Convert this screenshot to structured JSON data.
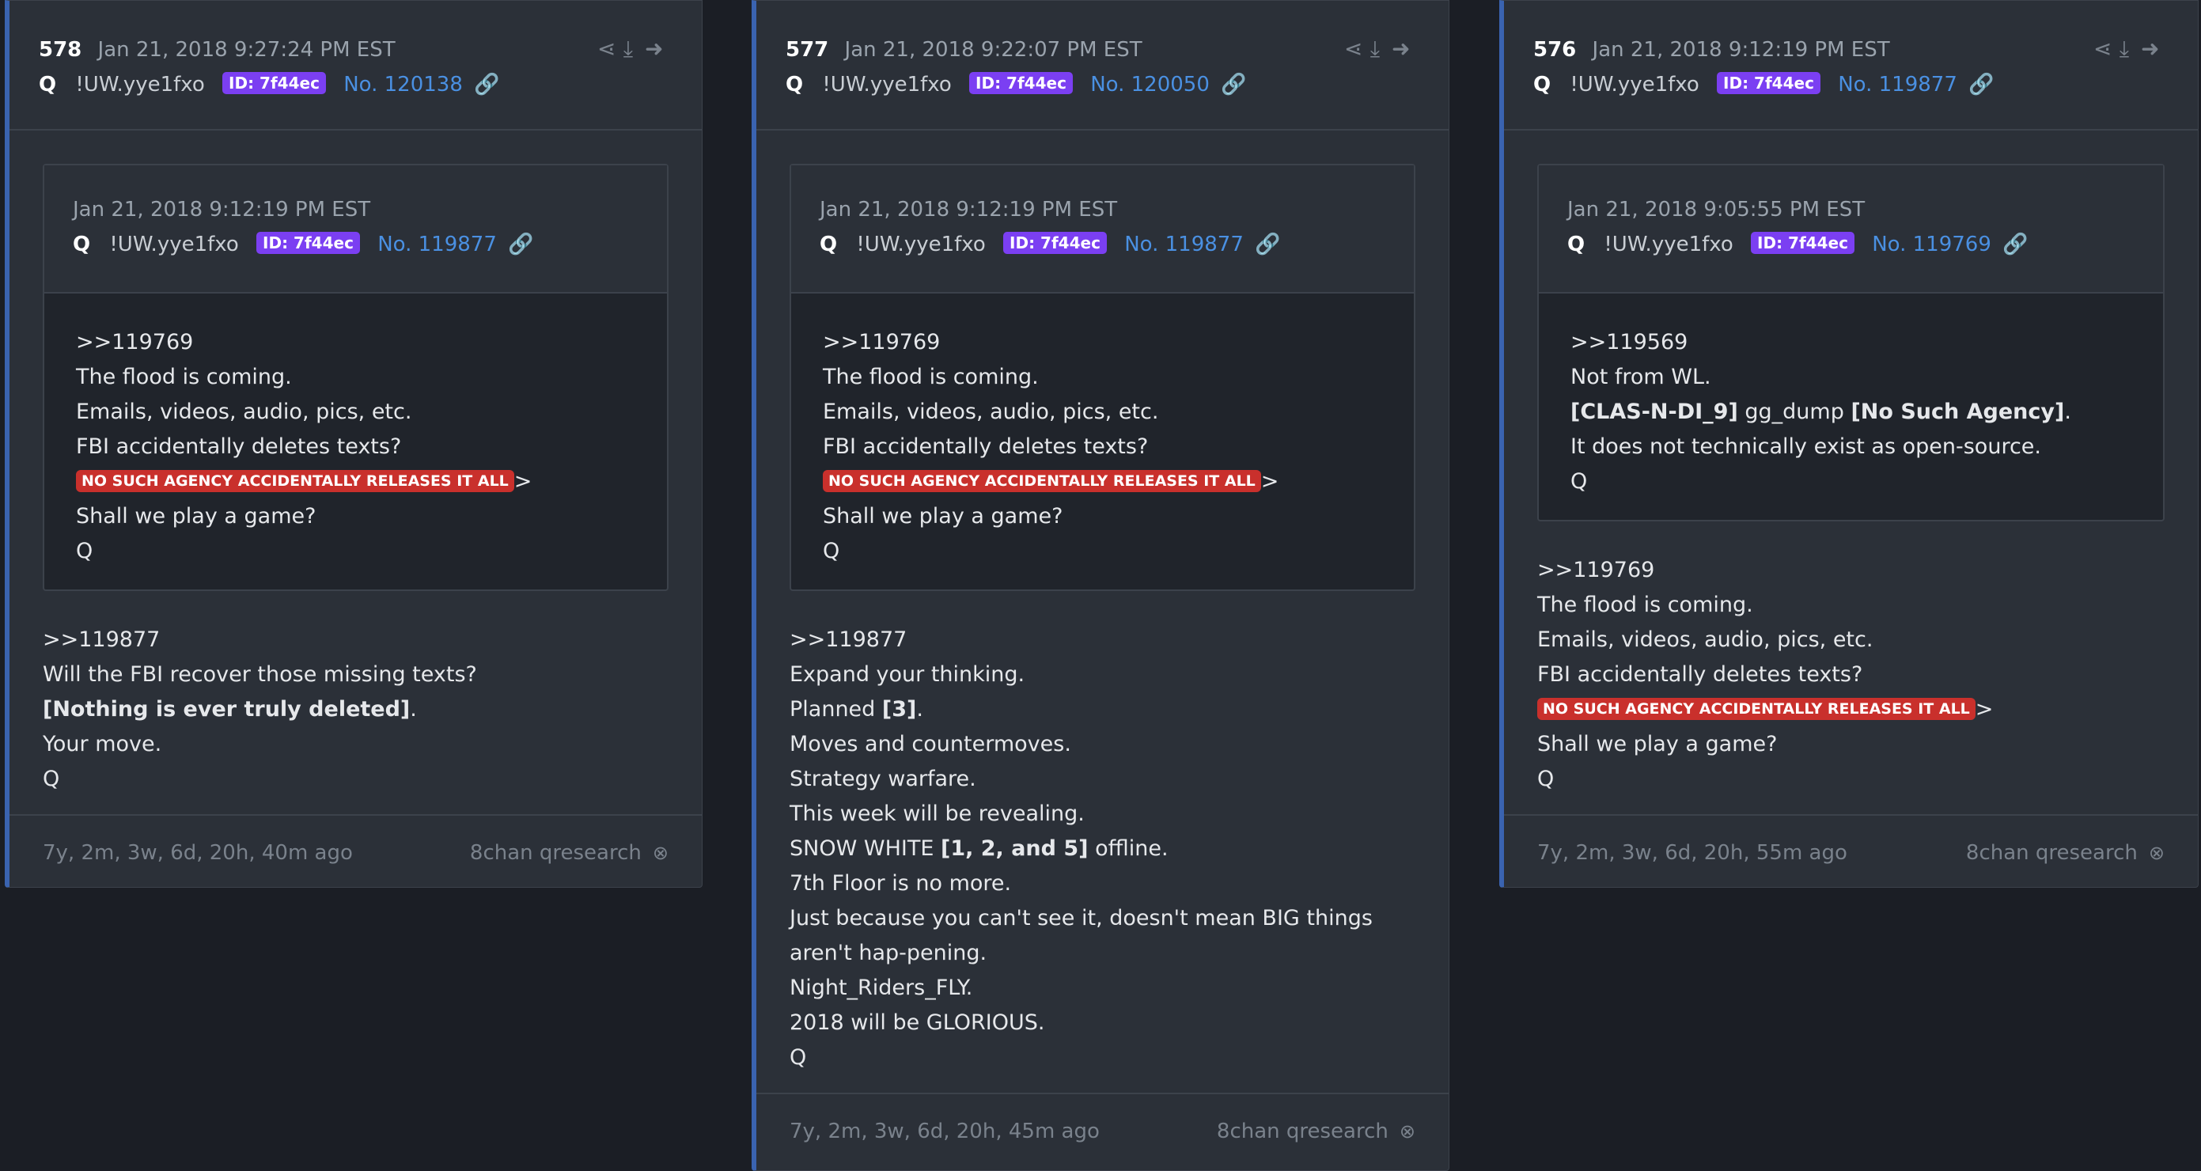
{
  "posts": [
    {
      "number": "578",
      "date": "Jan 21, 2018 9:27:24 PM EST",
      "author": "Q",
      "trip": "!UW.yye1fxo",
      "id_badge": "ID: 7f44ec",
      "post_no": "No. 120138",
      "quote": {
        "date": "Jan 21, 2018 9:12:19 PM EST",
        "author": "Q",
        "trip": "!UW.yye1fxo",
        "id_badge": "ID: 7f44ec",
        "post_no": "No. 119877",
        "lines": [
          ">>119769",
          "The flood is coming.",
          "Emails, videos, audio, pics, etc.",
          "FBI accidentally deletes texts?",
          "NO SUCH AGENCY ACCIDENTALLY RELEASES IT ALL",
          "Shall we play a game?",
          "Q"
        ]
      },
      "lines": [
        ">>119877",
        "Will the FBI recover those missing texts?",
        "[Nothing is ever truly deleted]",
        "Your move.",
        "Q"
      ],
      "age": "7y, 2m, 3w, 6d, 20h, 40m ago",
      "source": "8chan qresearch"
    },
    {
      "number": "577",
      "date": "Jan 21, 2018 9:22:07 PM EST",
      "author": "Q",
      "trip": "!UW.yye1fxo",
      "id_badge": "ID: 7f44ec",
      "post_no": "No. 120050",
      "quote": {
        "date": "Jan 21, 2018 9:12:19 PM EST",
        "author": "Q",
        "trip": "!UW.yye1fxo",
        "id_badge": "ID: 7f44ec",
        "post_no": "No. 119877",
        "lines": [
          ">>119769",
          "The flood is coming.",
          "Emails, videos, audio, pics, etc.",
          "FBI accidentally deletes texts?",
          "NO SUCH AGENCY ACCIDENTALLY RELEASES IT ALL",
          "Shall we play a game?",
          "Q"
        ]
      },
      "lines": [
        ">>119877",
        "Expand your thinking.",
        "Planned",
        "[3]",
        "Moves and countermoves.",
        "Strategy warfare.",
        "This week will be revealing.",
        "SNOW WHITE",
        "[1, 2, and 5]",
        "offline.",
        "7th Floor is no more.",
        "Just because you can't see it, doesn't mean BIG things aren't hap-pening.",
        "Night_Riders_FLY.",
        "2018 will be GLORIOUS.",
        "Q"
      ],
      "age": "7y, 2m, 3w, 6d, 20h, 45m ago",
      "source": "8chan qresearch"
    },
    {
      "number": "576",
      "date": "Jan 21, 2018 9:12:19 PM EST",
      "author": "Q",
      "trip": "!UW.yye1fxo",
      "id_badge": "ID: 7f44ec",
      "post_no": "No. 119877",
      "quote": {
        "date": "Jan 21, 2018 9:05:55 PM EST",
        "author": "Q",
        "trip": "!UW.yye1fxo",
        "id_badge": "ID: 7f44ec",
        "post_no": "No. 119769",
        "lines": [
          ">>119569",
          "Not from WL.",
          "[CLAS-N-DI_9]",
          "gg_dump",
          "[No Such Agency]",
          "It does not technically exist as open-source.",
          "Q"
        ]
      },
      "lines": [
        ">>119769",
        "The flood is coming.",
        "Emails, videos, audio, pics, etc.",
        "FBI accidentally deletes texts?",
        "NO SUCH AGENCY ACCIDENTALLY RELEASES IT ALL",
        "Shall we play a game?",
        "Q"
      ],
      "age": "7y, 2m, 3w, 6d, 20h, 55m ago",
      "source": "8chan qresearch"
    }
  ],
  "icons": {
    "share": "share-icon",
    "download": "download-icon",
    "arrow": "arrow-right-icon",
    "link": "link-icon",
    "close": "close-icon"
  },
  "colors": {
    "accent_border": "#3a63b0",
    "id_badge": "#7b3ff2",
    "red_badge": "#c9302c",
    "link": "#4a90e2"
  }
}
